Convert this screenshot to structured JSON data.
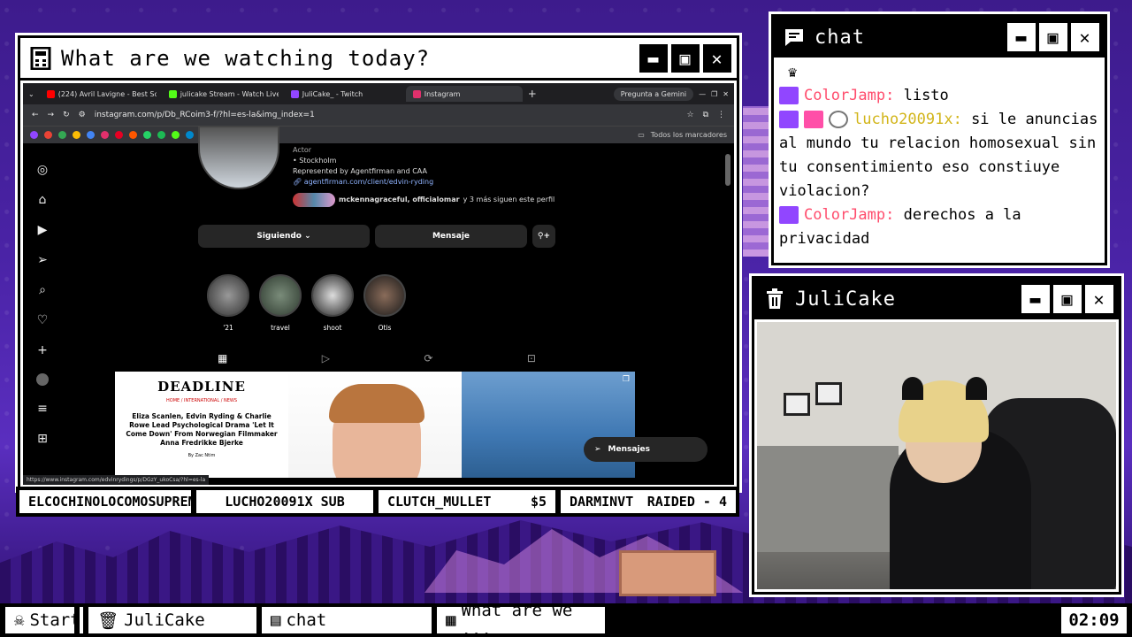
{
  "main_window": {
    "title": "What are we watching today?",
    "browser": {
      "tabs": [
        {
          "label": "(224) Avril Lavigne - Best So",
          "icon": "youtube-icon",
          "color": "#ff0000"
        },
        {
          "label": "julicake Stream - Watch Live",
          "icon": "kick-icon",
          "color": "#53fc18"
        },
        {
          "label": "JuliCake_ - Twitch",
          "icon": "twitch-icon",
          "color": "#9146ff"
        },
        {
          "label": "Instagram",
          "icon": "instagram-icon",
          "color": "#e1306c"
        }
      ],
      "gemini_label": "Pregunta a Gemini",
      "url": "instagram.com/p/Db_RCoim3-f/?hl=es-la&img_index=1",
      "bookmarks_label": "Todos los marcadores",
      "instagram": {
        "bio": {
          "role": "Actor",
          "location": "• Stockholm",
          "represented": "Represented by Agentfirman and CAA",
          "link": "agentfirman.com/client/edvin-ryding",
          "followers_names": "mckennagraceful, officialomar",
          "followers_rest": " y 3 más siguen este perfil"
        },
        "following_label": "Siguiendo ⌄",
        "message_label": "Mensaje",
        "highlights": [
          "'21",
          "travel",
          "shoot",
          "Otis"
        ],
        "post1": {
          "masthead": "DEADLINE",
          "section": "HOME / INTERNATIONAL / NEWS",
          "headline": "Eliza Scanlen, Edvin Ryding & Charlie Rowe Lead Psychological Drama 'Let It Come Down' From Norwegian Filmmaker Anna Fredrikke Bjerke",
          "byline": "By Zac Ntim"
        },
        "messages_label": "Mensajes",
        "status_url": "https://www.instagram.com/edvinrydings/p/DGzY_ukoCsa/?hl=es-la"
      }
    }
  },
  "ticker": [
    "ELCOCHINOLOCOMOSUPREMO(",
    "LUCHO20091X SUB",
    "CLUTCH_MULLET",
    "$5",
    "DARMINVT",
    "RAIDED - 4"
  ],
  "chat_window": {
    "title": "chat",
    "messages": [
      {
        "user": "ColorJamp:",
        "text": " listo",
        "badges": [
          "twitch"
        ]
      },
      {
        "user": "lucho20091x:",
        "text": " si le anuncias al mundo tu relacion homosexual sin tu consentimiento eso constiuye violacion?",
        "badges": [
          "twitch",
          "pink",
          "cat"
        ]
      },
      {
        "user": "ColorJamp:",
        "text": " derechos a la privacidad",
        "badges": [
          "twitch"
        ]
      }
    ]
  },
  "cam_window": {
    "title": "JuliCake"
  },
  "taskbar": {
    "start": "Start",
    "items": [
      "JuliCake",
      "chat",
      "What are we ..."
    ],
    "clock": "02:09"
  }
}
